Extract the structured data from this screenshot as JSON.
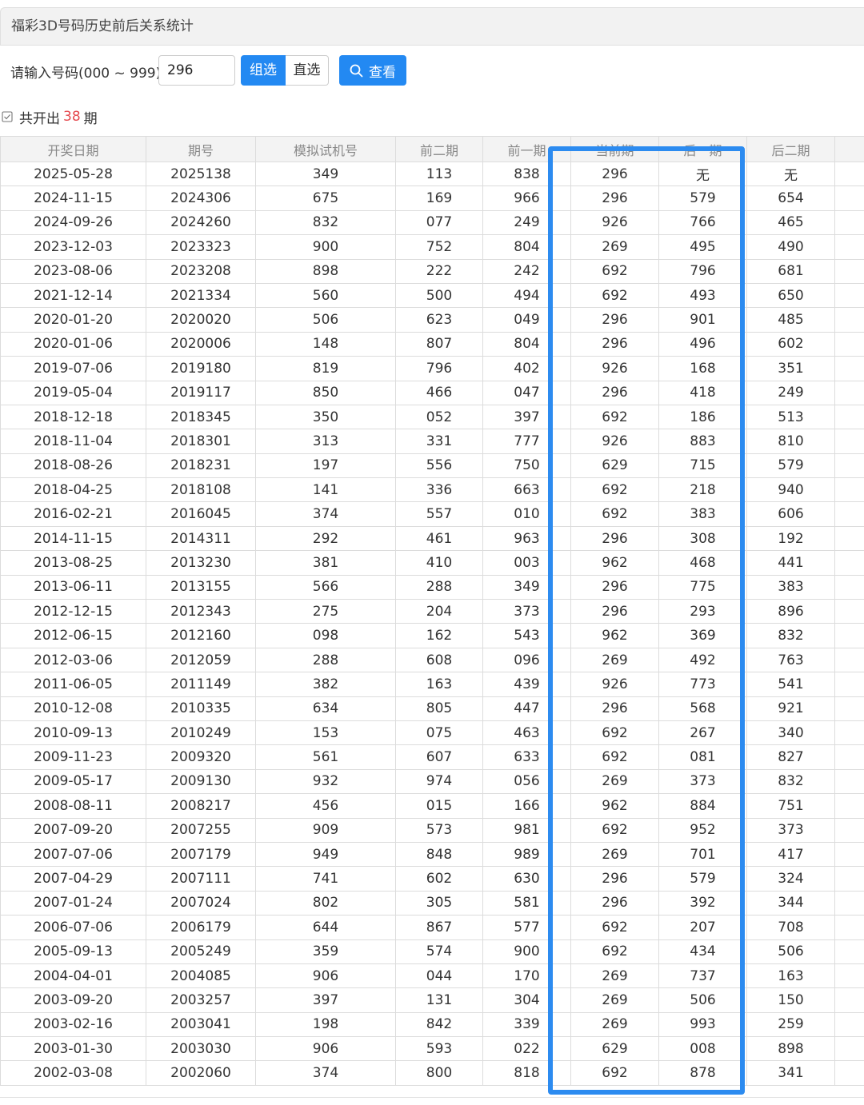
{
  "header": {
    "title": "福彩3D号码历史前后关系统计"
  },
  "query": {
    "label": "请输入号码(000 ~ 999)：",
    "input_value": "296",
    "btn_group_label": "组选",
    "btn_direct_label": "直选",
    "view_button_label": "查看",
    "view_button_icon": "search-icon"
  },
  "summary": {
    "prefix": "共开出",
    "count": "38",
    "suffix": "期"
  },
  "table": {
    "columns": [
      "开奖日期",
      "期号",
      "模拟试机号",
      "前二期",
      "前一期",
      "当前期",
      "后一期",
      "后二期"
    ],
    "rows": [
      [
        "2025-05-28",
        "2025138",
        "349",
        "113",
        "838",
        "296",
        "无",
        "无"
      ],
      [
        "2024-11-15",
        "2024306",
        "675",
        "169",
        "966",
        "296",
        "579",
        "654"
      ],
      [
        "2024-09-26",
        "2024260",
        "832",
        "077",
        "249",
        "926",
        "766",
        "465"
      ],
      [
        "2023-12-03",
        "2023323",
        "900",
        "752",
        "804",
        "269",
        "495",
        "490"
      ],
      [
        "2023-08-06",
        "2023208",
        "898",
        "222",
        "242",
        "692",
        "796",
        "681"
      ],
      [
        "2021-12-14",
        "2021334",
        "560",
        "500",
        "494",
        "692",
        "493",
        "650"
      ],
      [
        "2020-01-20",
        "2020020",
        "506",
        "623",
        "049",
        "296",
        "901",
        "485"
      ],
      [
        "2020-01-06",
        "2020006",
        "148",
        "807",
        "804",
        "296",
        "496",
        "602"
      ],
      [
        "2019-07-06",
        "2019180",
        "819",
        "796",
        "402",
        "926",
        "168",
        "351"
      ],
      [
        "2019-05-04",
        "2019117",
        "850",
        "466",
        "047",
        "296",
        "418",
        "249"
      ],
      [
        "2018-12-18",
        "2018345",
        "350",
        "052",
        "397",
        "692",
        "186",
        "513"
      ],
      [
        "2018-11-04",
        "2018301",
        "313",
        "331",
        "777",
        "926",
        "883",
        "810"
      ],
      [
        "2018-08-26",
        "2018231",
        "197",
        "556",
        "750",
        "629",
        "715",
        "579"
      ],
      [
        "2018-04-25",
        "2018108",
        "141",
        "336",
        "663",
        "692",
        "218",
        "940"
      ],
      [
        "2016-02-21",
        "2016045",
        "374",
        "557",
        "010",
        "692",
        "383",
        "606"
      ],
      [
        "2014-11-15",
        "2014311",
        "292",
        "461",
        "963",
        "296",
        "308",
        "192"
      ],
      [
        "2013-08-25",
        "2013230",
        "381",
        "410",
        "003",
        "962",
        "468",
        "441"
      ],
      [
        "2013-06-11",
        "2013155",
        "566",
        "288",
        "349",
        "296",
        "775",
        "383"
      ],
      [
        "2012-12-15",
        "2012343",
        "275",
        "204",
        "373",
        "296",
        "293",
        "896"
      ],
      [
        "2012-06-15",
        "2012160",
        "098",
        "162",
        "543",
        "962",
        "369",
        "832"
      ],
      [
        "2012-03-06",
        "2012059",
        "288",
        "608",
        "096",
        "269",
        "492",
        "763"
      ],
      [
        "2011-06-05",
        "2011149",
        "382",
        "163",
        "439",
        "926",
        "773",
        "541"
      ],
      [
        "2010-12-08",
        "2010335",
        "634",
        "805",
        "447",
        "296",
        "568",
        "921"
      ],
      [
        "2010-09-13",
        "2010249",
        "153",
        "075",
        "463",
        "692",
        "267",
        "340"
      ],
      [
        "2009-11-23",
        "2009320",
        "561",
        "607",
        "633",
        "692",
        "081",
        "827"
      ],
      [
        "2009-05-17",
        "2009130",
        "932",
        "974",
        "056",
        "269",
        "373",
        "832"
      ],
      [
        "2008-08-11",
        "2008217",
        "456",
        "015",
        "166",
        "962",
        "884",
        "751"
      ],
      [
        "2007-09-20",
        "2007255",
        "909",
        "573",
        "981",
        "692",
        "952",
        "373"
      ],
      [
        "2007-07-06",
        "2007179",
        "949",
        "848",
        "989",
        "269",
        "701",
        "417"
      ],
      [
        "2007-04-29",
        "2007111",
        "741",
        "602",
        "630",
        "296",
        "579",
        "324"
      ],
      [
        "2007-01-24",
        "2007024",
        "802",
        "305",
        "581",
        "296",
        "392",
        "344"
      ],
      [
        "2006-07-06",
        "2006179",
        "644",
        "867",
        "577",
        "692",
        "207",
        "708"
      ],
      [
        "2005-09-13",
        "2005249",
        "359",
        "574",
        "900",
        "692",
        "434",
        "506"
      ],
      [
        "2004-04-01",
        "2004085",
        "906",
        "044",
        "170",
        "269",
        "737",
        "163"
      ],
      [
        "2003-09-20",
        "2003257",
        "397",
        "131",
        "304",
        "269",
        "506",
        "150"
      ],
      [
        "2003-02-16",
        "2003041",
        "198",
        "842",
        "339",
        "269",
        "993",
        "259"
      ],
      [
        "2003-01-30",
        "2003030",
        "906",
        "593",
        "022",
        "629",
        "008",
        "898"
      ],
      [
        "2002-03-08",
        "2002060",
        "374",
        "800",
        "818",
        "692",
        "878",
        "341"
      ]
    ]
  },
  "colors": {
    "accent": "#2389f2",
    "highlight_box": "#2c8bf0",
    "count": "#e5484d"
  }
}
